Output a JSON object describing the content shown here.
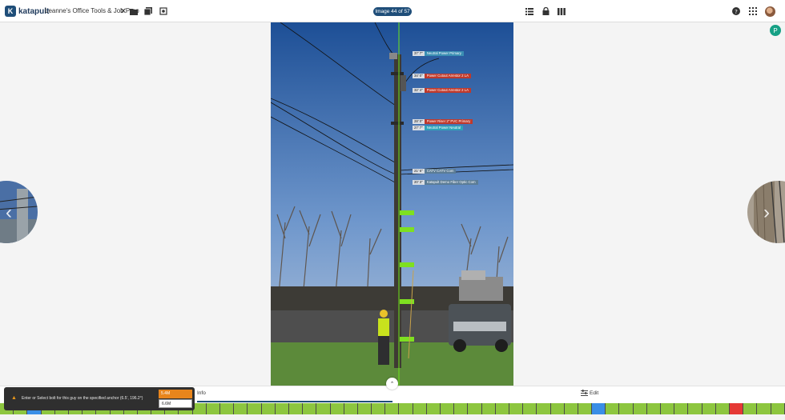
{
  "app": {
    "logo_mark": "K",
    "logo_text": "katapult"
  },
  "header": {
    "job_title": "Leanne's Office Tools & Job Prep",
    "close_glyph": "✕",
    "image_counter": "Image 44 of 57",
    "icons": [
      "folder-icon",
      "photos-icon",
      "camera-icon",
      "list-icon",
      "lock-icon",
      "columns-icon",
      "help-icon",
      "apps-grid-icon"
    ]
  },
  "user_badge": "P",
  "photo": {
    "labels": [
      {
        "height": "37' 7\"",
        "text": "Neutral  Power Primary",
        "color": "#3b8fb3"
      },
      {
        "height": "34' 0\"",
        "text": "Power Cutout Arrestor 2 LA",
        "color": "#c0392b"
      },
      {
        "height": "32' 4\"",
        "text": "Power Cutout Arrestor 2 LA",
        "color": "#c0392b"
      },
      {
        "height": "28' 0\"",
        "text": "Power Riser 2\" PVC Primary",
        "color": "#c0392b"
      },
      {
        "height": "27' 7\"",
        "text": "Neutral  Power Neutral",
        "color": "#2fa4b9"
      },
      {
        "height": "21' 6\"",
        "text": "CATV  CATV Com",
        "color": "#5b7c96"
      },
      {
        "height": "20' 3\"",
        "text": "Katapult Demo Fiber Optic Com",
        "color": "#5b7c96"
      }
    ]
  },
  "nav": {
    "prev_glyph": "‹",
    "next_glyph": "›",
    "expand_glyph": "⌃"
  },
  "bottom": {
    "info_tab": "Info",
    "edit_tab": "Edit",
    "edit_icon": "sliders-icon"
  },
  "toast": {
    "icon": "warning-icon",
    "warning_glyph": "▲",
    "message": "Enter or Select bolt for this guy on the specified anchor (6.5', 196.2°)",
    "options": [
      "5.4M",
      "6.6M"
    ]
  },
  "timeline": {
    "total": 57,
    "highlighted": [
      {
        "index": 2,
        "color": "#3a8ee6"
      },
      {
        "index": 43,
        "color": "#3a8ee6"
      },
      {
        "index": 53,
        "color": "#e53935"
      }
    ],
    "default_color": "#8dc63f"
  }
}
